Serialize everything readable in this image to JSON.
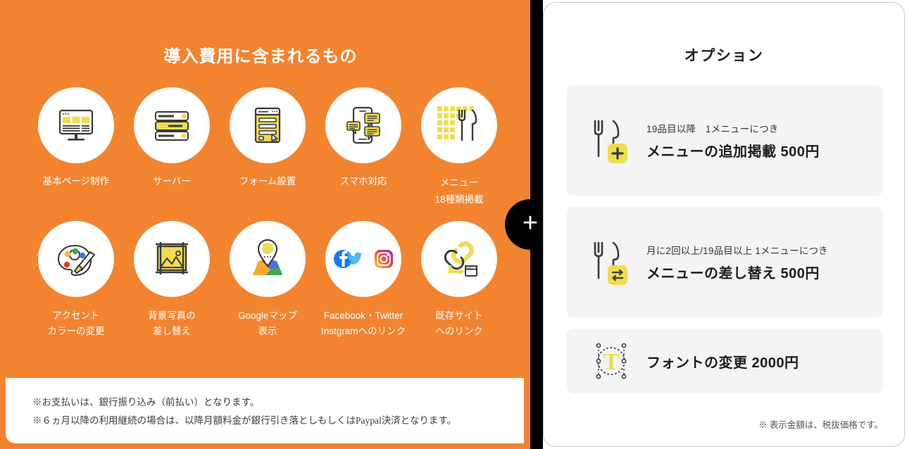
{
  "left": {
    "title": "導入費用に含まれるもの",
    "features_row1": [
      {
        "icon": "desktop-page-icon",
        "label": "基本ページ制作"
      },
      {
        "icon": "server-icon",
        "label": "サーバー"
      },
      {
        "icon": "form-icon",
        "label": "フォーム設置"
      },
      {
        "icon": "smartphone-chat-icon",
        "label": "スマホ対応"
      },
      {
        "icon": "menu-grid-cutlery-icon",
        "label": "メニュー",
        "sublabel": "18種類掲載"
      }
    ],
    "features_row2": [
      {
        "icon": "palette-brush-icon",
        "label": "アクセント\nカラーの変更"
      },
      {
        "icon": "photo-frame-icon",
        "label": "背景写真の\n差し替え"
      },
      {
        "icon": "google-map-pin-icon",
        "label": "Googleマップ\n表示"
      },
      {
        "icon": "social-media-icon",
        "label": "Facebook・Twitter\nInstgramへのリンク"
      },
      {
        "icon": "link-window-icon",
        "label": "既存サイト\nへのリンク"
      }
    ],
    "footnotes": [
      "※お支払いは、銀行振り込み（前払い）となります。",
      "※６ヵ月以降の利用継続の場合は、以降月額料金が銀行引き落としもしくはPaypal決済となります。"
    ]
  },
  "divider": {
    "symbol": "+",
    "icon": "plus-icon"
  },
  "right": {
    "title": "オプション",
    "options": [
      {
        "icon": "cutlery-plus-icon",
        "sub": "19品目以降　1メニューにつき",
        "main": "メニューの追加掲載  500円"
      },
      {
        "icon": "cutlery-swap-icon",
        "sub": "月に2回以上/19品目以上  1メニューにつき",
        "main": "メニューの差し替え  500円"
      },
      {
        "icon": "font-change-icon",
        "sub": "",
        "main": "フォントの変更  2000円"
      }
    ],
    "tax_note": "※ 表示金額は、税抜価格です。"
  },
  "colors": {
    "orange": "#F28430",
    "yellow": "#F0DC50",
    "dark": "#3A3A3A",
    "card_gray": "#F4F4F4",
    "white": "#FFFFFF",
    "black": "#000000"
  }
}
